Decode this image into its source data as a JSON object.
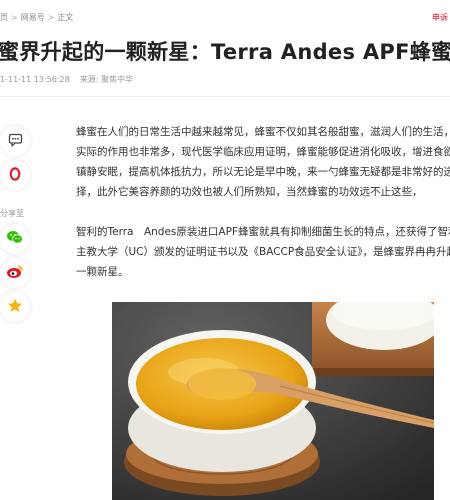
{
  "breadcrumb": {
    "items": [
      "页",
      "网易号",
      "正文"
    ],
    "report": "申诉"
  },
  "article": {
    "title": "蜜界升起的一颗新星：Terra Andes APF蜂蜜",
    "datetime": "1-11-11 13:56:28",
    "source": "来源: 聚焦中华",
    "paragraphs": [
      [
        "蜂蜜在人们的日常生活中越来越常见，蜂蜜不仅如其名般甜蜜，滋润人们的生活，",
        "实际的作用也非常多，现代医学临床应用证明，蜂蜜能够促进消化吸收，增进食欲，",
        "镇静安眠，提高机体抵抗力，所以无论是早中晚，来一勺蜂蜜无疑都是非常好的选",
        "择，此外它美容养颜的功效也被人们所熟知，当然蜂蜜的功效远不止这些，"
      ],
      [
        "智利的Terra　Andes原装进口APF蜂蜜就具有抑制细菌生长的特点，还获得了智利",
        "主教大学（UC）颁发的证明证书以及《BACCP食品安全认证》，是蜂蜜界冉冉升起的",
        "一颗新星。"
      ]
    ]
  },
  "share": {
    "label": "分享至",
    "icons": [
      "comment-icon",
      "opera-icon",
      "wechat-icon",
      "weibo-icon",
      "qzone-icon"
    ]
  },
  "colors": {
    "accent_red": "#d0021b",
    "wechat_green": "#2dc100",
    "weibo_red": "#e6162d",
    "qzone_yellow": "#f5b70f",
    "honey": "#e8a317"
  }
}
